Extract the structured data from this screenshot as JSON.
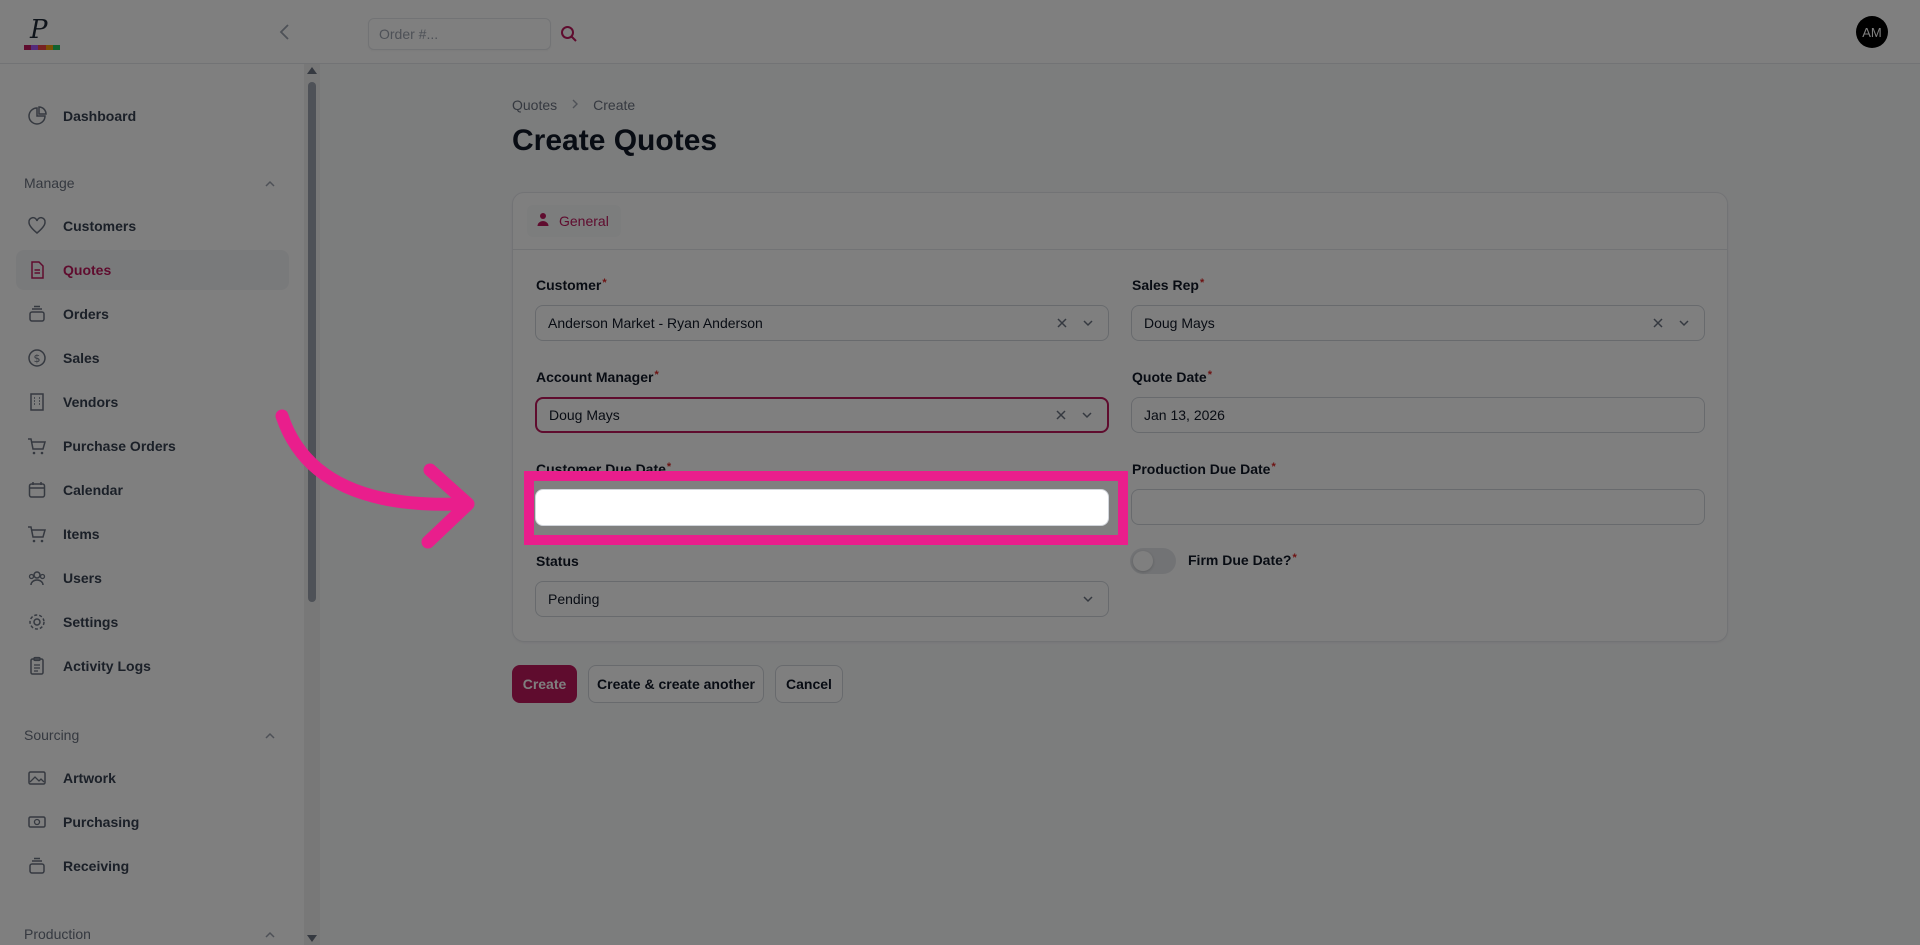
{
  "header": {
    "search_placeholder": "Order #...",
    "avatar_initials": "AM"
  },
  "sidebar": {
    "items_top": [
      {
        "label": "Dashboard",
        "icon": "pie-chart-icon"
      }
    ],
    "groups": [
      {
        "label": "Manage",
        "items": [
          {
            "label": "Customers",
            "icon": "heart-icon"
          },
          {
            "label": "Quotes",
            "icon": "document-icon",
            "active": true
          },
          {
            "label": "Orders",
            "icon": "stack-icon"
          },
          {
            "label": "Sales",
            "icon": "dollar-icon"
          },
          {
            "label": "Vendors",
            "icon": "building-icon"
          },
          {
            "label": "Purchase Orders",
            "icon": "cart-icon"
          },
          {
            "label": "Calendar",
            "icon": "calendar-icon"
          },
          {
            "label": "Items",
            "icon": "cart-icon"
          },
          {
            "label": "Users",
            "icon": "users-icon"
          },
          {
            "label": "Settings",
            "icon": "gear-icon"
          },
          {
            "label": "Activity Logs",
            "icon": "clipboard-icon"
          }
        ]
      },
      {
        "label": "Sourcing",
        "items": [
          {
            "label": "Artwork",
            "icon": "image-icon"
          },
          {
            "label": "Purchasing",
            "icon": "cash-icon"
          },
          {
            "label": "Receiving",
            "icon": "stack-icon"
          }
        ]
      },
      {
        "label": "Production",
        "items": []
      }
    ]
  },
  "breadcrumb": {
    "parent": "Quotes",
    "current": "Create"
  },
  "page_title": "Create Quotes",
  "tab": {
    "label": "General"
  },
  "form": {
    "customer": {
      "label": "Customer",
      "value": "Anderson Market - Ryan Anderson"
    },
    "sales_rep": {
      "label": "Sales Rep",
      "value": "Doug Mays"
    },
    "account_manager": {
      "label": "Account Manager",
      "value": "Doug Mays"
    },
    "quote_date": {
      "label": "Quote Date",
      "value": "Jan 13, 2026"
    },
    "customer_due_date": {
      "label": "Customer Due Date",
      "value": ""
    },
    "production_due_date": {
      "label": "Production Due Date",
      "value": ""
    },
    "status": {
      "label": "Status",
      "value": "Pending"
    },
    "firm_due_date": {
      "label": "Firm Due Date?",
      "checked": false
    }
  },
  "actions": {
    "create": "Create",
    "create_another": "Create & create another",
    "cancel": "Cancel"
  },
  "colors": {
    "accent": "#be185d",
    "highlight": "#e91e8c"
  }
}
